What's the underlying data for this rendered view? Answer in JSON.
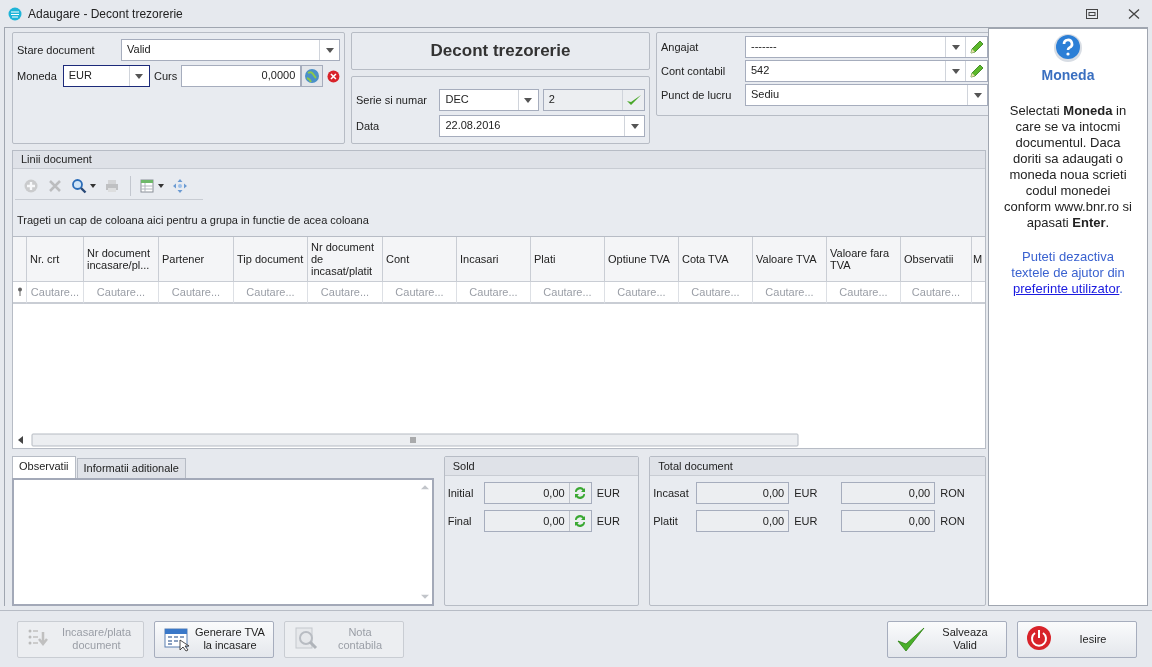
{
  "window": {
    "title": "Adaugare - Decont trezorerie"
  },
  "general": {
    "status": {
      "label": "Stare document",
      "value": "Valid"
    },
    "currency": {
      "label": "Moneda",
      "value": "EUR",
      "focused": true
    },
    "rate": {
      "label": "Curs",
      "value": "0,0000"
    }
  },
  "title_panel": {
    "title": "Decont trezorerie"
  },
  "series": {
    "label": "Serie si numar",
    "series_value": "DEC",
    "number_value": "2",
    "date_label": "Data",
    "date_value": "22.08.2016"
  },
  "employee": {
    "fields": [
      {
        "label": "Angajat",
        "value": "-------",
        "editable": true
      },
      {
        "label": "Cont contabil",
        "value": "542",
        "editable": true
      },
      {
        "label": "Punct de lucru",
        "value": "Sediu",
        "editable": false
      }
    ]
  },
  "lines": {
    "title": "Linii document",
    "toolbar": [
      {
        "kind": "add",
        "disabled": true,
        "dropdown": false,
        "separated": false
      },
      {
        "kind": "delete",
        "disabled": true,
        "dropdown": false,
        "separated": false
      },
      {
        "kind": "search",
        "disabled": false,
        "dropdown": true,
        "separated": false
      },
      {
        "kind": "print",
        "disabled": true,
        "dropdown": false,
        "separated": false
      },
      {
        "kind": "layout",
        "disabled": false,
        "dropdown": true,
        "separated": true
      },
      {
        "kind": "move",
        "disabled": false,
        "dropdown": false,
        "separated": false
      }
    ],
    "group_hint": "Trageti un cap de coloana aici pentru a grupa in functie de acea coloana",
    "columns": [
      {
        "header": "Nr. crt",
        "filter": "Cautare..."
      },
      {
        "header": "Nr document incasare/pl...",
        "filter": "Cautare..."
      },
      {
        "header": "Partener",
        "filter": "Cautare..."
      },
      {
        "header": "Tip document",
        "filter": "Cautare..."
      },
      {
        "header": "Nr document de incasat/platit",
        "filter": "Cautare..."
      },
      {
        "header": "Cont",
        "filter": "Cautare..."
      },
      {
        "header": "Incasari",
        "filter": "Cautare..."
      },
      {
        "header": "Plati",
        "filter": "Cautare..."
      },
      {
        "header": "Optiune TVA",
        "filter": "Cautare..."
      },
      {
        "header": "Cota TVA",
        "filter": "Cautare..."
      },
      {
        "header": "Valoare TVA",
        "filter": "Cautare..."
      },
      {
        "header": "Valoare fara TVA",
        "filter": "Cautare..."
      },
      {
        "header": "Observatii",
        "filter": "Cautare..."
      },
      {
        "header": "M"
      }
    ]
  },
  "notes": {
    "tabs": [
      {
        "label": "Observatii",
        "selected": true
      },
      {
        "label": "Informatii aditionale",
        "selected": false
      }
    ]
  },
  "sold": {
    "title": "Sold",
    "rows": [
      {
        "label": "Initial",
        "value": "0,00",
        "currency": "EUR"
      },
      {
        "label": "Final",
        "value": "0,00",
        "currency": "EUR"
      }
    ]
  },
  "totals": {
    "title": "Total document",
    "rows": [
      {
        "label": "Incasat",
        "value": "0,00",
        "currency": "EUR",
        "value_ron": "0,00",
        "currency_ron": "RON"
      },
      {
        "label": "Platit",
        "value": "0,00",
        "currency": "EUR",
        "value_ron": "0,00",
        "currency_ron": "RON"
      }
    ]
  },
  "help": {
    "title": "Moneda",
    "body": "Selectati **Moneda** in care se va intocmi documentul. Daca doriti sa adaugati o moneda noua scrieti codul monedei conform www.bnr.ro si apasati **Enter**.",
    "note": "Puteti dezactiva textele de ajutor din",
    "link": "preferinte utilizator",
    "note_end": "."
  },
  "actions": [
    {
      "kind": "list",
      "label": "Incasare/plata document",
      "disabled": true
    },
    {
      "kind": "calendar",
      "label": "Generare TVA la incasare",
      "disabled": false
    },
    {
      "kind": "magnifier",
      "label": "Nota contabila",
      "disabled": true
    }
  ],
  "dialog_buttons": [
    {
      "kind": "check",
      "label": "Salveaza Valid"
    },
    {
      "kind": "power",
      "label": "Iesire"
    }
  ]
}
